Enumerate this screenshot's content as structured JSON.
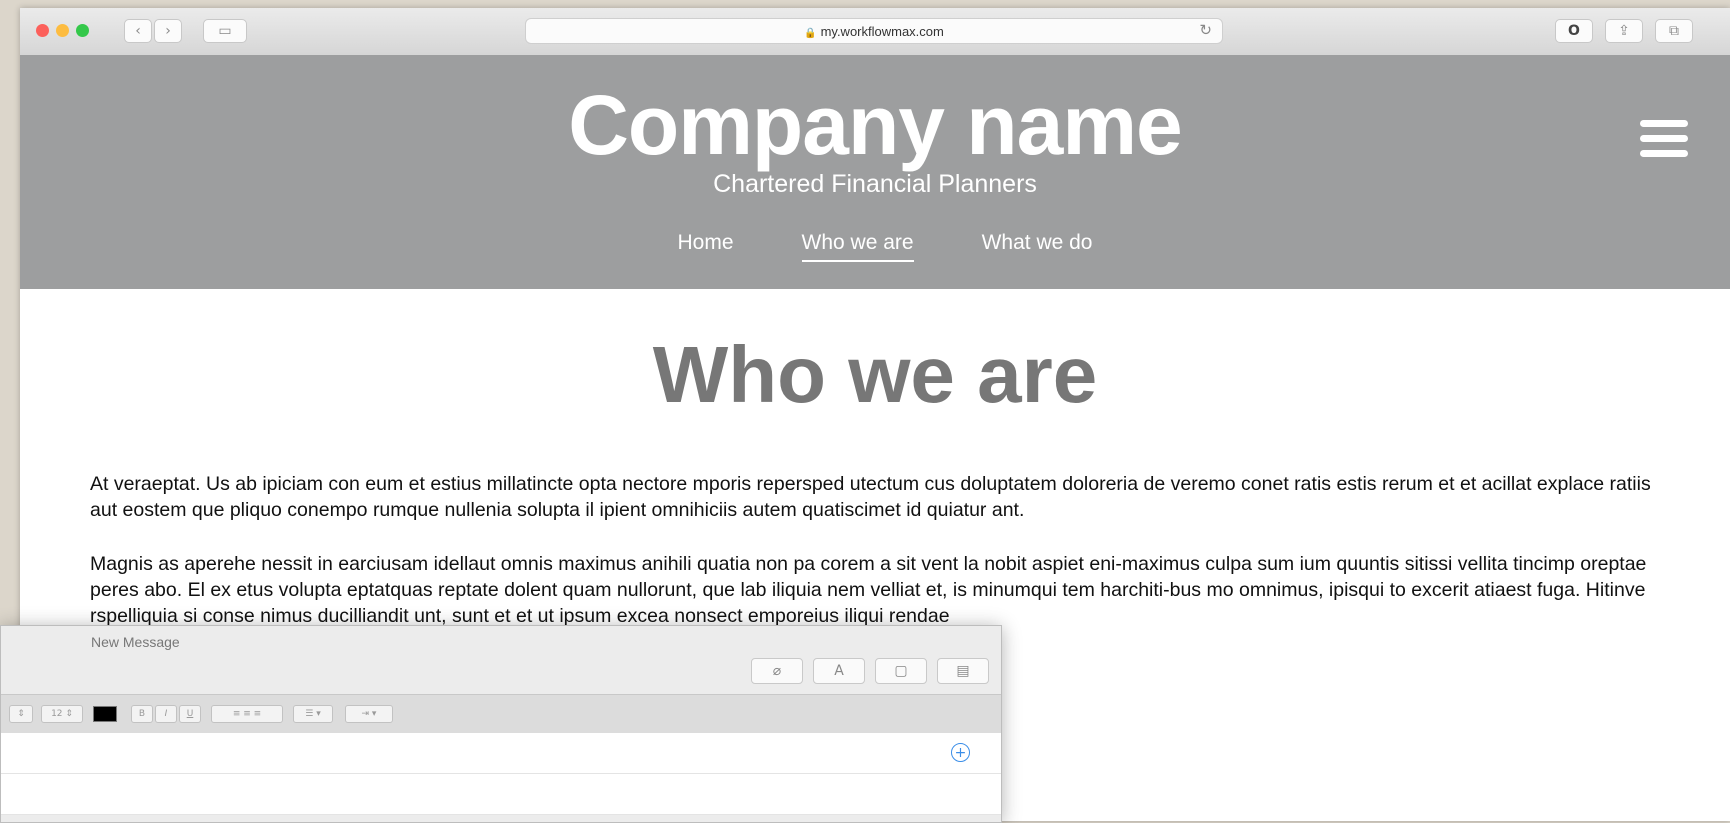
{
  "browser": {
    "url": "my.workflowmax.com",
    "back_glyph": "‹",
    "forward_glyph": "›",
    "sidebar_glyph": "▭",
    "reload_glyph": "↻",
    "lock_glyph": "🔒",
    "extension_glyph": "O",
    "share_glyph": "⇪",
    "tabs_glyph": "⧉"
  },
  "site": {
    "company_name": "Company name",
    "tagline": "Chartered Financial Planners",
    "nav": [
      "Home",
      "Who we are",
      "What we do"
    ],
    "active_nav": "Who we are"
  },
  "page": {
    "title": "Who we are",
    "paragraph1": "At veraeptat. Us ab ipiciam con eum et estius millatincte opta nectore mporis repersped utectum cus doluptatem doloreria de veremo conet ratis estis rerum et et acillat explace ratiis aut eostem que pliquo conempo rumque nullenia solupta il ipient omnihiciis autem quatiscimet id quiatur ant.",
    "paragraph2": "Magnis as aperehe nessit in earciusam idellaut omnis maximus anihili quatia non pa corem a sit vent la nobit aspiet eni-maximus culpa sum ium quuntis sitissi vellita tincimp oreptae peres abo. El ex etus volupta eptatquas reptate dolent quam nullorunt, que lab iliquia nem velliat et, is minumqui tem harchiti-bus mo omnimus, ipisqui to excerit atiaest fuga. Hitinve rspelliquia si conse nimus ducilliandit unt, sunt et et ut ipsum excea nonsect emporeius iliqui rendae"
  },
  "mail": {
    "title": "New Message",
    "toolbar_glyphs": [
      "⌀",
      "A",
      "▢",
      "▤"
    ],
    "format": {
      "font_size": "12",
      "bold": "B",
      "italic": "I",
      "underline": "U",
      "text_color": "#000000"
    },
    "add_glyph": "+"
  }
}
